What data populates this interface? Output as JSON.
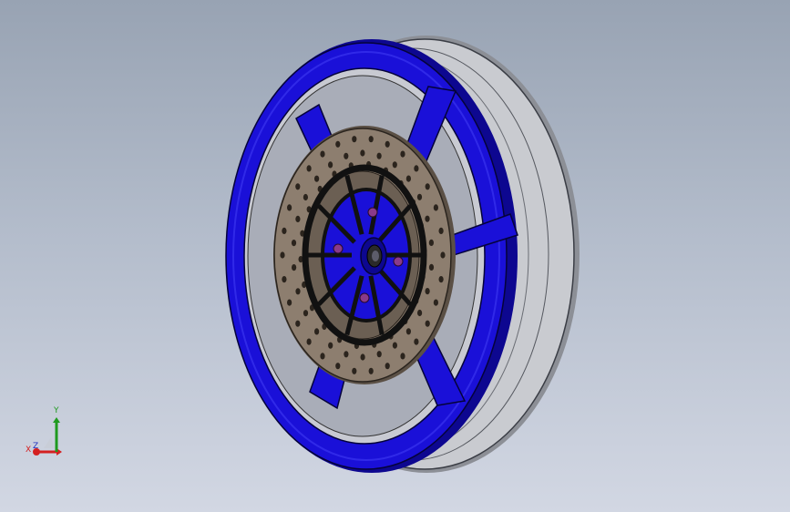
{
  "viewport": {
    "background_top": "#98a3b3",
    "background_bottom": "#d2d7e3"
  },
  "model": {
    "part": "wheel",
    "rim_color": "#1a10d8",
    "rim_dark": "#0d0790",
    "tire_color": "#c9cbd0",
    "disc_color": "#8d7e6f",
    "carrier_color": "#111111",
    "bolt_color": "#8a3a8a",
    "spoke_count": 5,
    "disc_bolt_count": 5
  },
  "triad": {
    "y_label": "Y",
    "x_label": "X",
    "z_label": "Z",
    "y_color": "#1f9a1f",
    "x_color": "#d42020",
    "z_color": "#2030c0"
  }
}
